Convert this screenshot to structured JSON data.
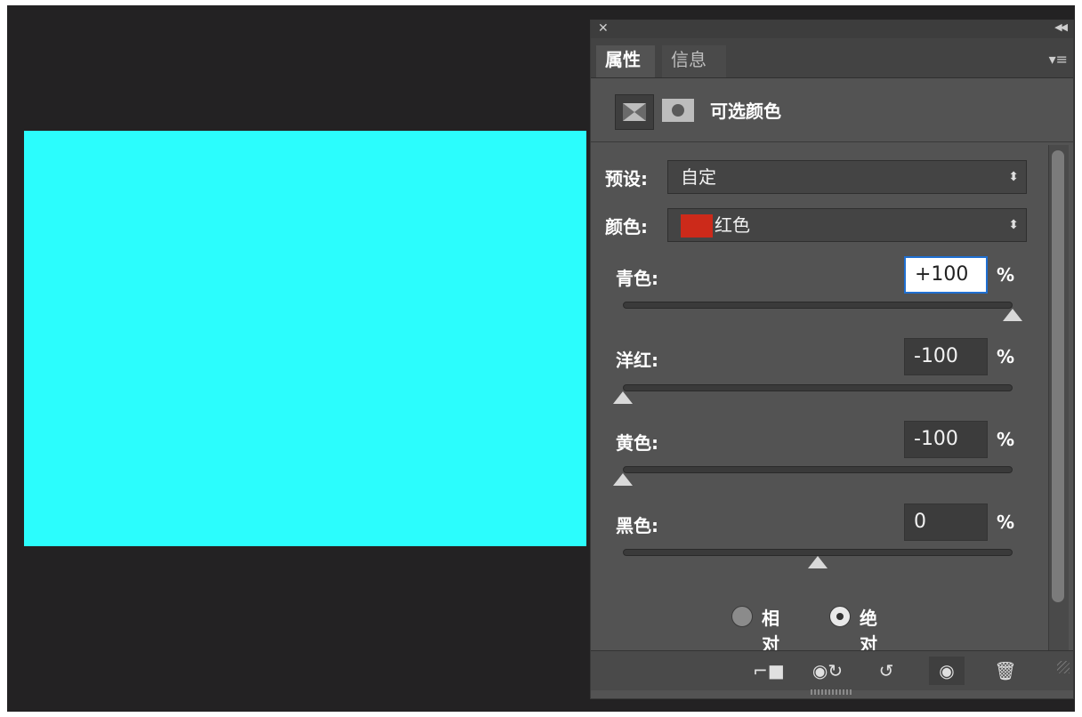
{
  "colors": {
    "canvas_fill": "#2bfdfd",
    "swatch_red": "#cc2a1a"
  },
  "panel": {
    "close_icon": "close-icon",
    "collapse_icon": "double-chevron-right-icon",
    "tabs": [
      "属性",
      "信息"
    ],
    "active_tab": "属性",
    "menu_icon": "panel-menu-icon",
    "adjustment_title": "可选颜色",
    "preset": {
      "label": "预设:",
      "value": "自定"
    },
    "color": {
      "label": "颜色:",
      "value": "红色"
    },
    "sliders": [
      {
        "label": "青色:",
        "value": "+100",
        "unit": "%",
        "level": 1.0
      },
      {
        "label": "洋红:",
        "value": "-100",
        "unit": "%",
        "level": 0.0
      },
      {
        "label": "黄色:",
        "value": "-100",
        "unit": "%",
        "level": 0.0
      },
      {
        "label": "黑色:",
        "value": "0",
        "unit": "%",
        "level": 0.5
      }
    ],
    "method": {
      "options": [
        "相对",
        "绝对"
      ],
      "selected": "绝对"
    },
    "bottom_icons": [
      "clip-to-layer-icon",
      "view-previous-icon",
      "reset-icon",
      "visibility-eye-icon",
      "trash-icon"
    ]
  }
}
